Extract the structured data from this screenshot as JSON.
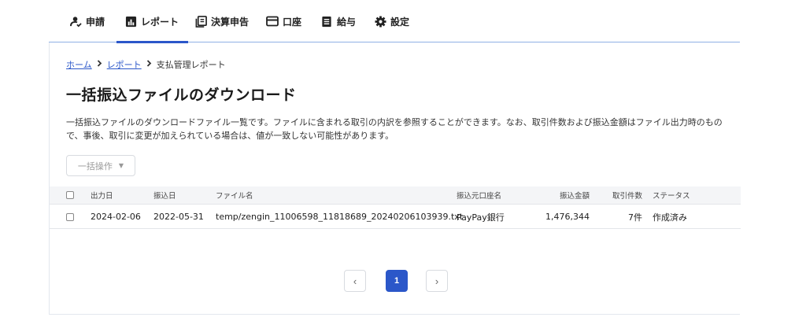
{
  "nav": {
    "items": [
      {
        "label": "申請",
        "icon": "user-check-icon"
      },
      {
        "label": "レポート",
        "icon": "bar-chart-icon",
        "active": true
      },
      {
        "label": "決算申告",
        "icon": "document-stack-icon"
      },
      {
        "label": "口座",
        "icon": "card-icon"
      },
      {
        "label": "給与",
        "icon": "list-doc-icon"
      },
      {
        "label": "設定",
        "icon": "gear-icon"
      }
    ]
  },
  "breadcrumb": {
    "home": "ホーム",
    "report": "レポート",
    "current": "支払管理レポート"
  },
  "page": {
    "title": "一括振込ファイルのダウンロード",
    "description_line1": "一括振込ファイルのダウンロードファイル一覧です。ファイルに含まれる取引の内訳を参照することができます。なお、取引件数および振込金額はファイル出力時のもの",
    "description_line2": "で、事後、取引に変更が加えられている場合は、値が一致しない可能性があります。"
  },
  "bulk_action": {
    "label": "一括操作"
  },
  "table": {
    "headers": {
      "output_date": "出力日",
      "transfer_date": "振込日",
      "file_name": "ファイル名",
      "source_account": "振込元口座名",
      "amount": "振込金額",
      "count": "取引件数",
      "status": "ステータス"
    },
    "rows": [
      {
        "output_date": "2024-02-06",
        "transfer_date": "2022-05-31",
        "file_name": "temp/zengin_11006598_11818689_20240206103939.txt",
        "source_account": "PayPay銀行",
        "amount": "1,476,344",
        "count": "7件",
        "status": "作成済み"
      }
    ]
  },
  "pagination": {
    "prev": "‹",
    "current": "1",
    "next": "›"
  },
  "colors": {
    "accent": "#2b57c9",
    "nav_border": "#8fb0e4",
    "header_bg": "#f4f5f7"
  }
}
